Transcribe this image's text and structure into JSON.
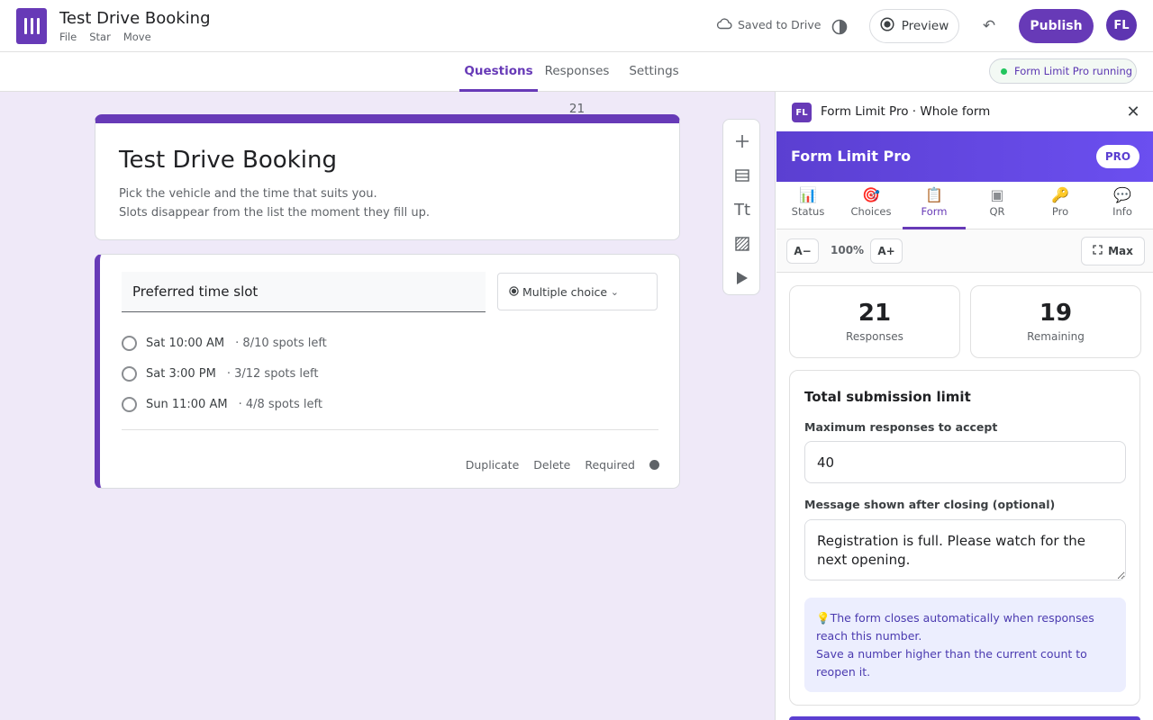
{
  "header": {
    "title": "Test Drive Booking",
    "menu": [
      "File",
      "Star",
      "Move"
    ],
    "saved": "Saved to Drive",
    "preview": "Preview",
    "publish": "Publish",
    "avatar": "FL"
  },
  "tabs": {
    "questions": "Questions",
    "responses": "Responses 21",
    "settings": "Settings"
  },
  "running_pill": "Form Limit Pro running",
  "form": {
    "title": "Test Drive Booking",
    "description_line1": "Pick the vehicle and the time that suits you.",
    "description_line2": "Slots disappear from the list the moment they fill up."
  },
  "question": {
    "title": "Preferred time slot",
    "type": "Multiple choice",
    "options": [
      {
        "label": "Sat 10:00 AM",
        "meta": "· 8/10 spots left"
      },
      {
        "label": "Sat 3:00 PM",
        "meta": "· 3/12 spots left"
      },
      {
        "label": "Sun 11:00 AM",
        "meta": "· 4/8 spots left"
      }
    ],
    "duplicate": "Duplicate",
    "delete": "Delete",
    "required": "Required"
  },
  "side_tools": [
    "add-question-icon",
    "import-icon",
    "title-text-icon",
    "image-icon",
    "video-icon"
  ],
  "side_tools_glyphs": {
    "text": "Tt"
  },
  "panel": {
    "badge": "FL",
    "title": "Form Limit Pro · Whole form",
    "banner_title": "Form Limit Pro",
    "pro_badge": "PRO",
    "tabs": [
      {
        "label": "Status",
        "icon": "📊"
      },
      {
        "label": "Choices",
        "icon": "🎯"
      },
      {
        "label": "Form",
        "icon": "📋"
      },
      {
        "label": "QR",
        "icon": "▣"
      },
      {
        "label": "Pro",
        "icon": "🔑"
      },
      {
        "label": "Info",
        "icon": "💬"
      }
    ],
    "active_tab": "Form",
    "zoom": {
      "minus": "A−",
      "value": "100%",
      "plus": "A+",
      "max": "Max"
    },
    "stats": {
      "responses_value": "21",
      "responses_label": "Responses",
      "remaining_value": "19",
      "remaining_label": "Remaining"
    },
    "limit_card": {
      "title": "Total submission limit",
      "max_label": "Maximum responses to accept",
      "max_value": "40",
      "message_label": "Message shown after closing (optional)",
      "message_value": "Registration is full. Please watch for the next opening.",
      "info_line1": "💡The form closes automatically when responses reach this number.",
      "info_line2": "Save a number higher than the current count to reopen it."
    }
  },
  "colors": {
    "accent": "#673ab7",
    "banner": "#5b3fd1",
    "running_dot": "#22c55e"
  }
}
